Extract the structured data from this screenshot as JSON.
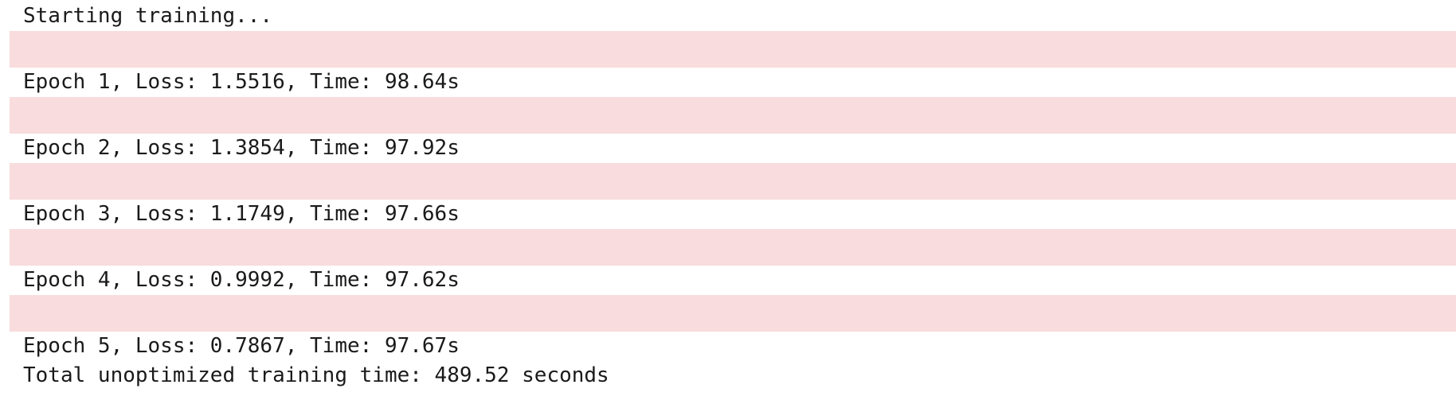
{
  "output": {
    "stderr_color": "#f9dcdd",
    "lines": {
      "start": "Starting training...",
      "epoch1": "Epoch 1, Loss: 1.5516, Time: 98.64s",
      "epoch2": "Epoch 2, Loss: 1.3854, Time: 97.92s",
      "epoch3": "Epoch 3, Loss: 1.1749, Time: 97.66s",
      "epoch4": "Epoch 4, Loss: 0.9992, Time: 97.62s",
      "epoch5": "Epoch 5, Loss: 0.7867, Time: 97.67s",
      "total": "Total unoptimized training time: 489.52 seconds"
    }
  }
}
